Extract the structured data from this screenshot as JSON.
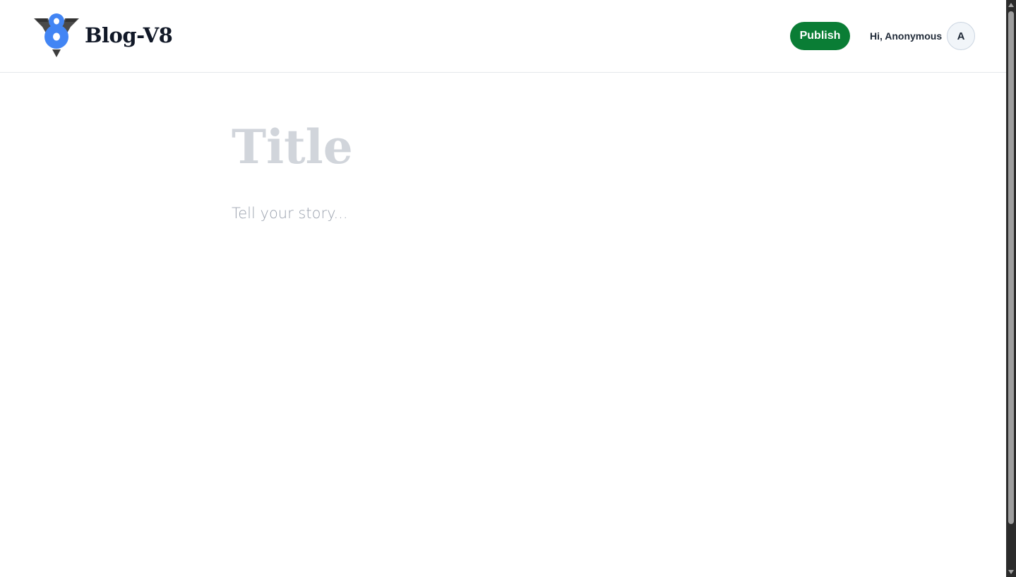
{
  "header": {
    "brand_name": "Blog-V8",
    "logo_icon": "v8-logo-icon",
    "publish_label": "Publish",
    "greeting": "Hi, Anonymous",
    "avatar_initial": "A"
  },
  "editor": {
    "title_placeholder": "Title",
    "body_placeholder": "Tell your story..."
  },
  "colors": {
    "publish_button": "#0a7d35",
    "logo_blue": "#4285f4",
    "logo_dark": "#4a4a4a",
    "title_placeholder": "#d1d5db",
    "body_placeholder": "#9ca3af"
  }
}
